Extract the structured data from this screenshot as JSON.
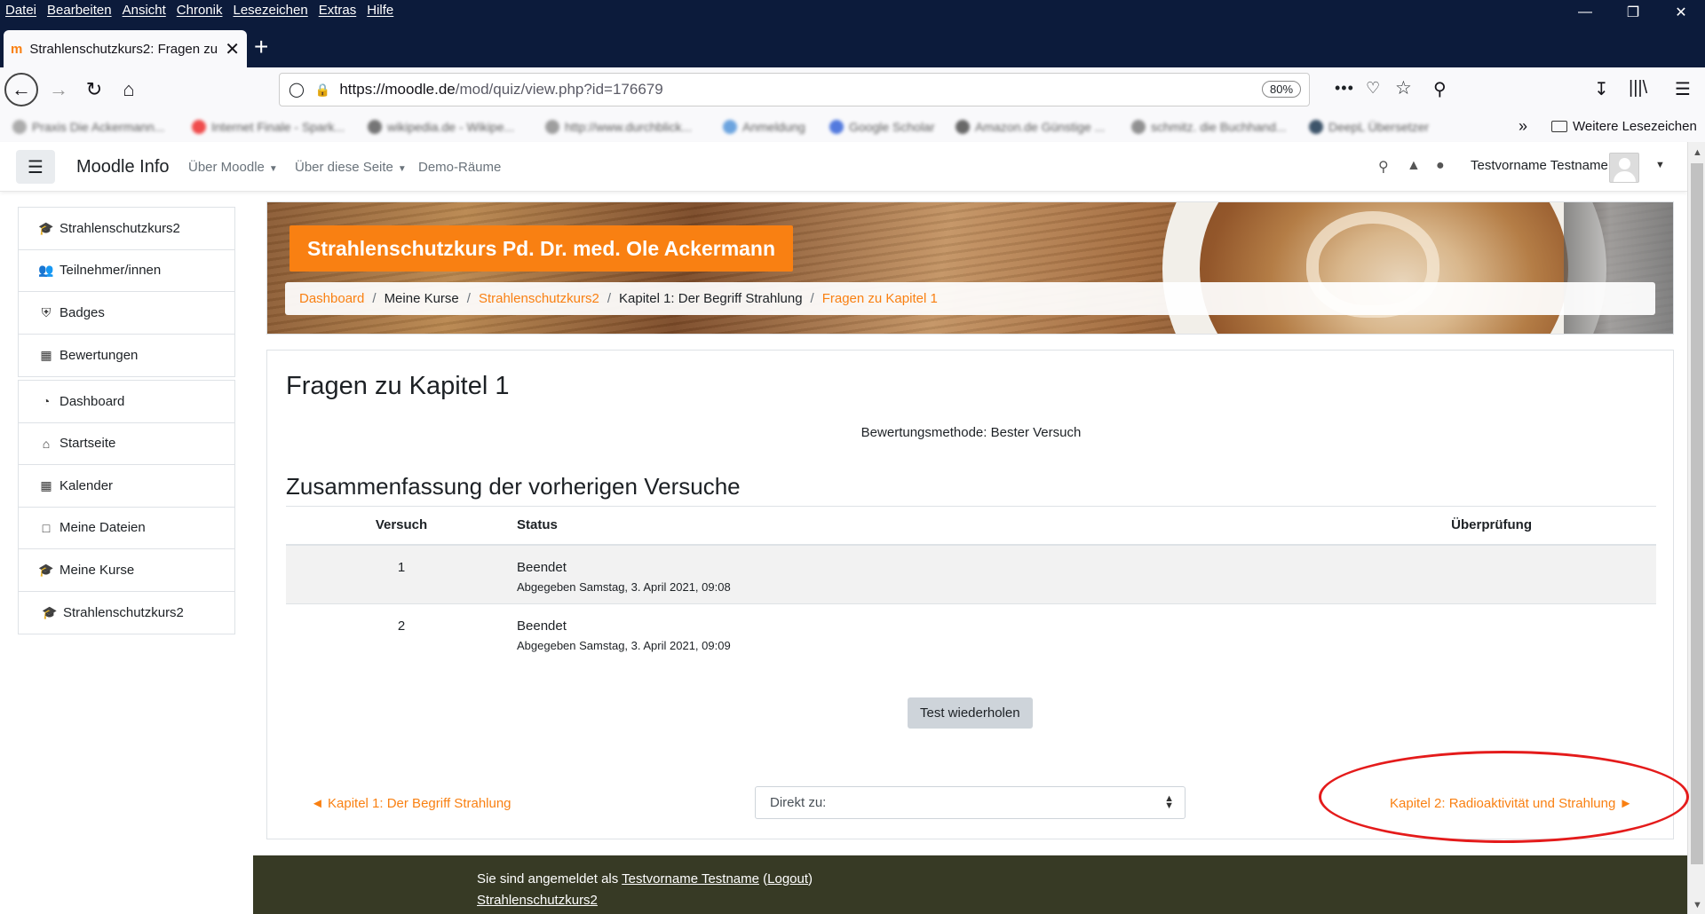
{
  "browser": {
    "menu": [
      "Datei",
      "Bearbeiten",
      "Ansicht",
      "Chronik",
      "Lesezeichen",
      "Extras",
      "Hilfe"
    ],
    "tab_title": "Strahlenschutzkurs2: Fragen zu",
    "url_host": "https://moodle.de",
    "url_path": "/mod/quiz/view.php?id=176679",
    "zoom": "80%",
    "bookmarks": [
      "Praxis Die Ackermann...",
      "Internet Finale - Spark...",
      "wikipedia.de - Wikipe...",
      "http://www.durchblick...",
      "Anmeldung",
      "Google Scholar",
      "Amazon.de Günstige ...",
      "schmitz. die Buchhand...",
      "DeepL Übersetzer"
    ],
    "bookmarks_folder": "Weitere Lesezeichen"
  },
  "moodle_nav": {
    "brand": "Moodle Info",
    "links": [
      "Über Moodle",
      "Über diese Seite",
      "Demo-Räume"
    ],
    "user_name": "Testvorname Testname"
  },
  "sidebar": {
    "block1": [
      {
        "label": "Strahlenschutzkurs2",
        "icon": "graduation-cap-icon"
      },
      {
        "label": "Teilnehmer/innen",
        "icon": "users-icon"
      },
      {
        "label": "Badges",
        "icon": "shield-icon"
      },
      {
        "label": "Bewertungen",
        "icon": "table-icon"
      }
    ],
    "block2": [
      {
        "label": "Dashboard",
        "icon": "dashboard-icon"
      },
      {
        "label": "Startseite",
        "icon": "home-icon"
      },
      {
        "label": "Kalender",
        "icon": "calendar-icon"
      },
      {
        "label": "Meine Dateien",
        "icon": "file-icon"
      },
      {
        "label": "Meine Kurse",
        "icon": "graduation-cap-icon"
      },
      {
        "label": "Strahlenschutzkurs2",
        "icon": "graduation-cap-icon"
      }
    ]
  },
  "header": {
    "course_title": "Strahlenschutzkurs Pd. Dr. med. Ole Ackermann",
    "breadcrumb": [
      "Dashboard",
      "Meine Kurse",
      "Strahlenschutzkurs2",
      "Kapitel 1: Der Begriff Strahlung",
      "Fragen zu Kapitel 1"
    ]
  },
  "main": {
    "title": "Fragen zu Kapitel 1",
    "grading_method": "Bewertungsmethode: Bester Versuch",
    "summary_heading": "Zusammenfassung der vorherigen Versuche",
    "table_headers": [
      "Versuch",
      "Status",
      "Überprüfung"
    ],
    "attempts": [
      {
        "number": "1",
        "status": "Beendet",
        "submitted": "Abgegeben Samstag, 3. April 2021, 09:08"
      },
      {
        "number": "2",
        "status": "Beendet",
        "submitted": "Abgegeben Samstag, 3. April 2021, 09:09"
      }
    ],
    "retry_button": "Test wiederholen",
    "prev_activity": "◄ Kapitel 1: Der Begriff Strahlung",
    "jump_to_placeholder": "Direkt zu:",
    "next_activity": "Kapitel 2: Radioaktivität und Strahlung ►"
  },
  "footer": {
    "logged_in_prefix": "Sie sind angemeldet als ",
    "user_link": "Testvorname Testname",
    "logout_open": " (",
    "logout": "Logout",
    "logout_close": ")",
    "course_link": "Strahlenschutzkurs2"
  },
  "colors": {
    "moodle_orange": "#f98012",
    "annotation_red": "#e41b1b",
    "footer_bg": "#373a25",
    "browser_chrome": "#0c1b3b"
  }
}
